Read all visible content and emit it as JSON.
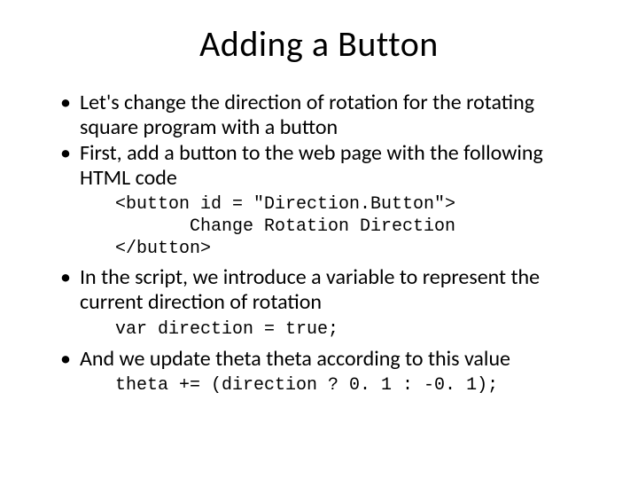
{
  "slide": {
    "title": "Adding a Button",
    "bullets": [
      {
        "text": "Let's change the direction of rotation for the rotating square program with a button"
      },
      {
        "text": "First, add a button to the web page with the following HTML code",
        "code": "<button id = \"Direction.Button\">\n       Change Rotation Direction\n</button>"
      },
      {
        "text": "In the script, we introduce a variable to represent the current direction of rotation",
        "code": "var direction = true;"
      },
      {
        "text": "And we update theta theta according to this value",
        "code": "theta += (direction ? 0. 1 : -0. 1);"
      }
    ]
  }
}
